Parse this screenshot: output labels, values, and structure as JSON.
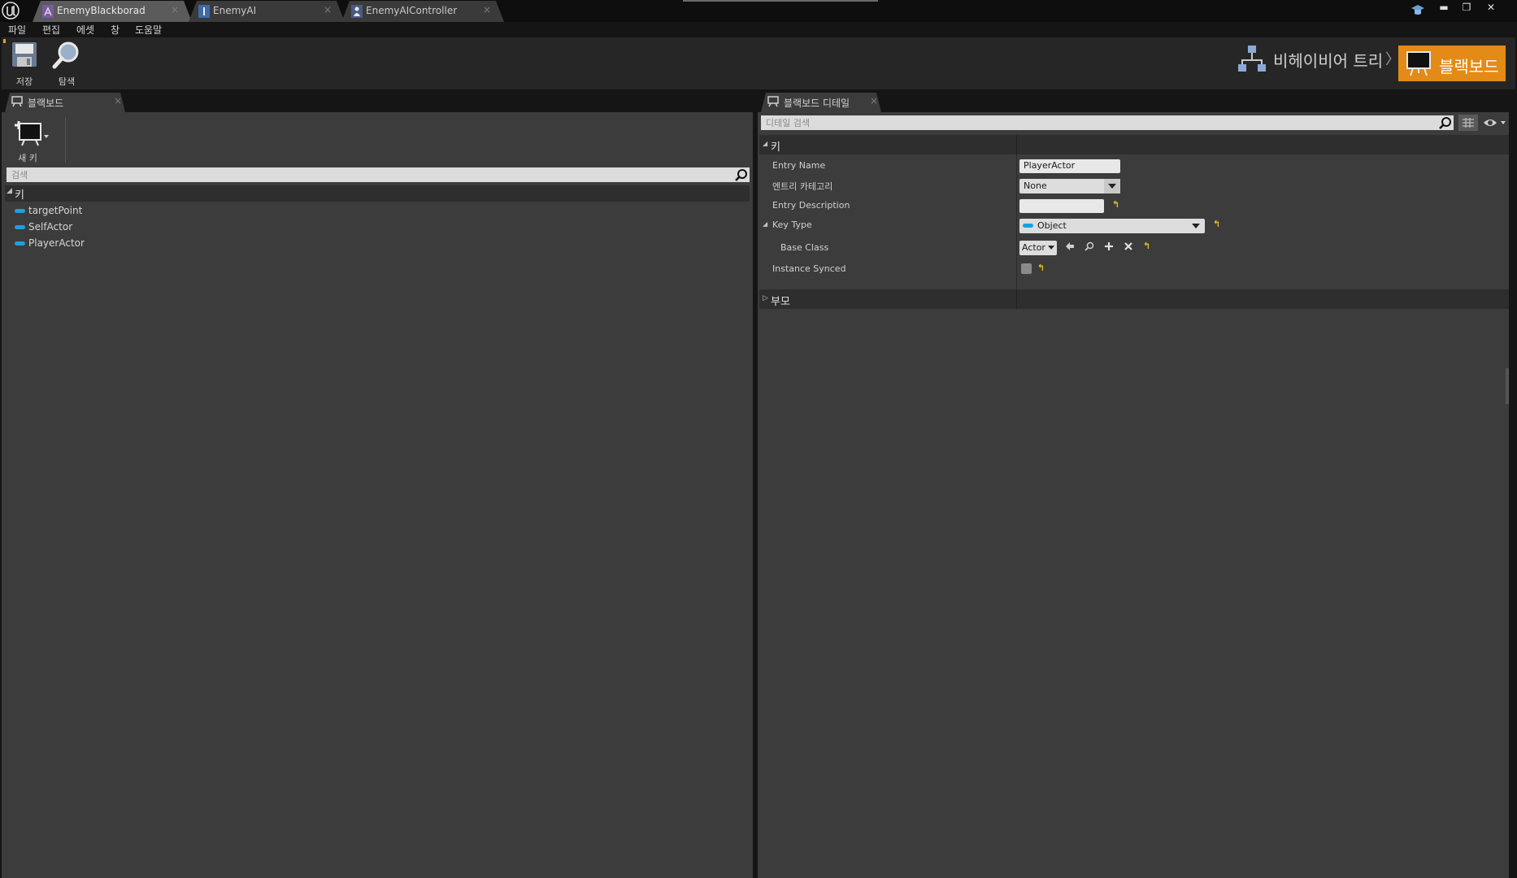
{
  "window": {
    "tabs": [
      {
        "label": "EnemyBlackborad",
        "active": true,
        "icon": "blackboard-asset-icon"
      },
      {
        "label": "EnemyAI",
        "active": false,
        "icon": "behavior-tree-asset-icon"
      },
      {
        "label": "EnemyAIController",
        "active": false,
        "icon": "ai-controller-asset-icon"
      }
    ],
    "tab_close": "×",
    "controls": {
      "minimize": "▬",
      "maximize": "❐",
      "close": "✕"
    }
  },
  "menu": {
    "items": [
      "파일",
      "편집",
      "에셋",
      "창",
      "도움말"
    ]
  },
  "toolbar": {
    "save_label": "저장",
    "browse_label": "탐색",
    "breadcrumb": {
      "behavior_tree": "비헤이비어 트리",
      "separator": "〉",
      "blackboard": "블랙보드"
    },
    "accent_color": "#e48a16"
  },
  "left_panel": {
    "tab_label": "블랙보드",
    "new_key_label": "새 키",
    "search_placeholder": "검색",
    "section_label": "키",
    "keys": [
      "targetPoint",
      "SelfActor",
      "PlayerActor"
    ],
    "key_color": "#1aa0e6"
  },
  "right_panel": {
    "tab_label": "블랙보드 디테일",
    "search_placeholder": "디테일 검색",
    "section_key": "키",
    "section_parent": "부모",
    "props": {
      "entry_name_label": "Entry Name",
      "entry_name_value": "PlayerActor",
      "entry_category_label": "엔트리 카테고리",
      "entry_category_value": "None",
      "entry_description_label": "Entry Description",
      "entry_description_value": "",
      "key_type_label": "Key Type",
      "key_type_value": "Object",
      "base_class_label": "Base Class",
      "base_class_value": "Actor",
      "instance_synced_label": "Instance Synced",
      "instance_synced_checked": false
    }
  }
}
